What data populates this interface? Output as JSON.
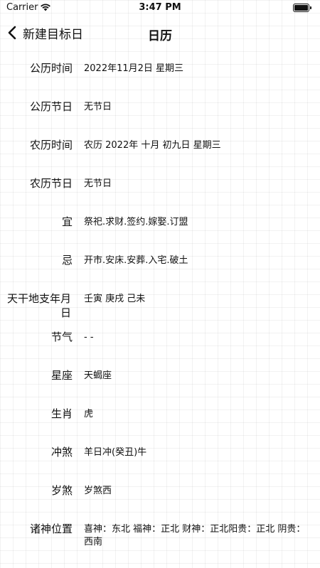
{
  "status_bar": {
    "carrier": "Carrier",
    "time": "3:47 PM"
  },
  "nav": {
    "back_label": "新建目标日",
    "title": "日历"
  },
  "rows": [
    {
      "label": "公历时间",
      "value": "2022年11月2日 星期三"
    },
    {
      "label": "公历节日",
      "value": "无节日"
    },
    {
      "label": "农历时间",
      "value": "农历 2022年 十月 初九日 星期三"
    },
    {
      "label": "农历节日",
      "value": "无节日"
    },
    {
      "label": "宜",
      "value": "祭祀.求财.签约.嫁娶.订盟"
    },
    {
      "label": "忌",
      "value": "开市.安床.安葬.入宅.破土"
    },
    {
      "label": "天干地支年月日",
      "value": "壬寅 庚戌 己未"
    },
    {
      "label": "节气",
      "value": "- -"
    },
    {
      "label": "星座",
      "value": "天蝎座"
    },
    {
      "label": "生肖",
      "value": "虎"
    },
    {
      "label": "冲煞",
      "value": "羊日冲(癸丑)牛"
    },
    {
      "label": "岁煞",
      "value": "岁煞西"
    },
    {
      "label": "诸神位置",
      "value": "喜神：东北 福神：正北 财神：正北阳贵：正北 阴贵：西南"
    }
  ]
}
